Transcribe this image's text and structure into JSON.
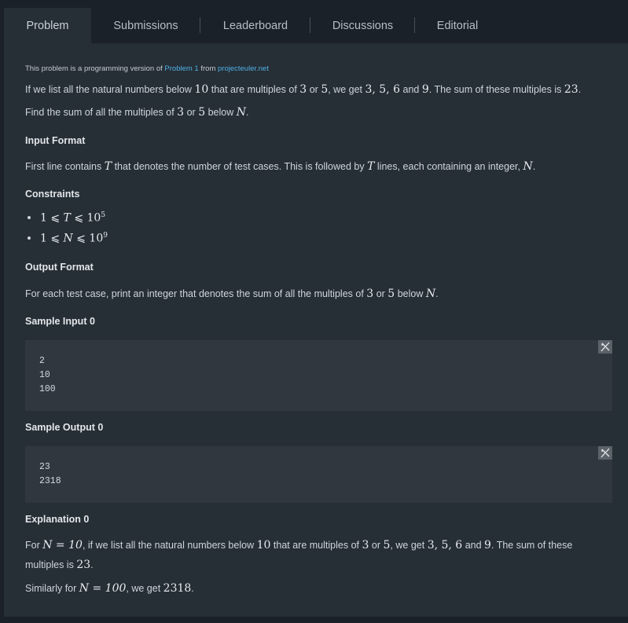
{
  "tabs": [
    {
      "label": "Problem",
      "active": true
    },
    {
      "label": "Submissions",
      "active": false
    },
    {
      "label": "Leaderboard",
      "active": false
    },
    {
      "label": "Discussions",
      "active": false
    },
    {
      "label": "Editorial",
      "active": false
    }
  ],
  "note": {
    "prefix": "This problem is a programming version of",
    "link1": "Problem 1",
    "mid": "from",
    "link2": "projecteuler.net"
  },
  "intro": {
    "t1": "If we list all the natural numbers below",
    "n10": "10",
    "t2": "that are multiples of",
    "n3": "3",
    "or": "or",
    "n5": "5",
    "t3": ", we get",
    "list": "3, 5, 6",
    "and": "and",
    "n9": "9",
    "t4": ". The sum of these multiples is",
    "n23": "23",
    "end": "."
  },
  "find": {
    "t1": "Find the sum of all the multiples of",
    "n3": "3",
    "or": "or",
    "n5": "5",
    "t2": "below",
    "N": "N",
    "end": "."
  },
  "input_format": {
    "heading": "Input Format",
    "t1": "First line contains",
    "T1": "T",
    "t2": "that denotes the number of test cases. This is followed by",
    "T2": "T",
    "t3": "lines, each containing an integer,",
    "N": "N",
    "end": "."
  },
  "constraints": {
    "heading": "Constraints",
    "c1": {
      "left": "1 ⩽ ",
      "var": "T",
      "mid": " ⩽ 10",
      "exp": "5"
    },
    "c2": {
      "left": "1 ⩽ ",
      "var": "N",
      "mid": " ⩽ 10",
      "exp": "9"
    }
  },
  "output_format": {
    "heading": "Output Format",
    "t1": "For each test case, print an integer that denotes the sum of all the multiples of",
    "n3": "3",
    "or": "or",
    "n5": "5",
    "t2": "below",
    "N": "N",
    "end": "."
  },
  "sample_input": {
    "heading": "Sample Input 0",
    "code": "2\n10\n100"
  },
  "sample_output": {
    "heading": "Sample Output 0",
    "code": "23\n2318"
  },
  "explanation": {
    "heading": "Explanation 0",
    "l1": {
      "t1": "For",
      "eq": "N = 10",
      "t2": ", if we list all the natural numbers below",
      "n10": "10",
      "t3": "that are multiples of",
      "n3": "3",
      "or": "or",
      "n5": "5",
      "t4": ", we get",
      "list": "3, 5, 6",
      "and": "and",
      "n9": "9",
      "t5": ". The sum of these"
    },
    "l2": {
      "t1": "multiples is",
      "n23": "23",
      "end": "."
    },
    "l3": {
      "t1": "Similarly for",
      "eq": "N = 100",
      "t2": ", we get",
      "n": "2318",
      "end": "."
    }
  },
  "icons": {
    "copy": "copy-icon"
  }
}
